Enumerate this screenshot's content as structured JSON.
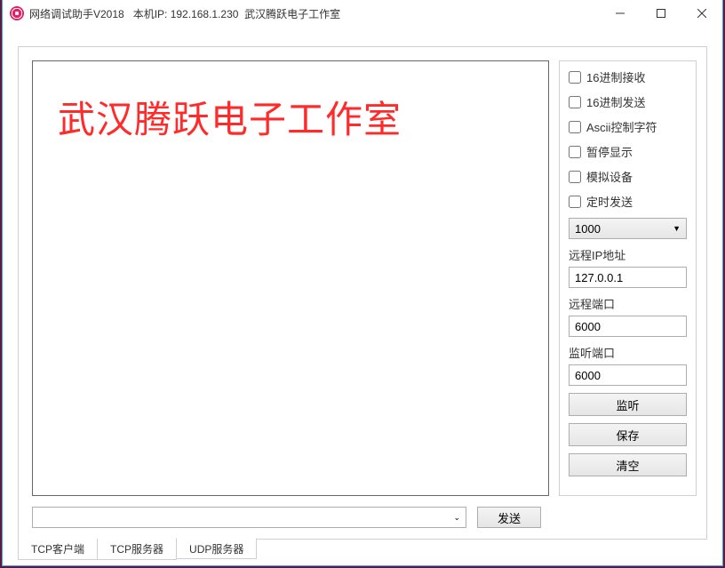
{
  "titlebar": {
    "text": "网络调试助手V2018   本机IP: 192.168.1.230  武汉腾跃电子工作室"
  },
  "watermark": "武汉腾跃电子工作室",
  "checks": {
    "hex_recv": "16进制接收",
    "hex_send": "16进制发送",
    "ascii_ctrl": "Ascii控制字符",
    "pause": "暂停显示",
    "sim_dev": "模拟设备",
    "timed_send": "定时发送"
  },
  "interval": {
    "value": "1000"
  },
  "labels": {
    "remote_ip": "远程IP地址",
    "remote_port": "远程端口",
    "listen_port": "监听端口"
  },
  "fields": {
    "remote_ip": "127.0.0.1",
    "remote_port": "6000",
    "listen_port": "6000"
  },
  "buttons": {
    "listen": "监听",
    "save": "保存",
    "clear": "清空",
    "send": "发送"
  },
  "send_input": "",
  "tabs": {
    "tcp_client": "TCP客户端",
    "tcp_server": "TCP服务器",
    "udp_server": "UDP服务器"
  }
}
